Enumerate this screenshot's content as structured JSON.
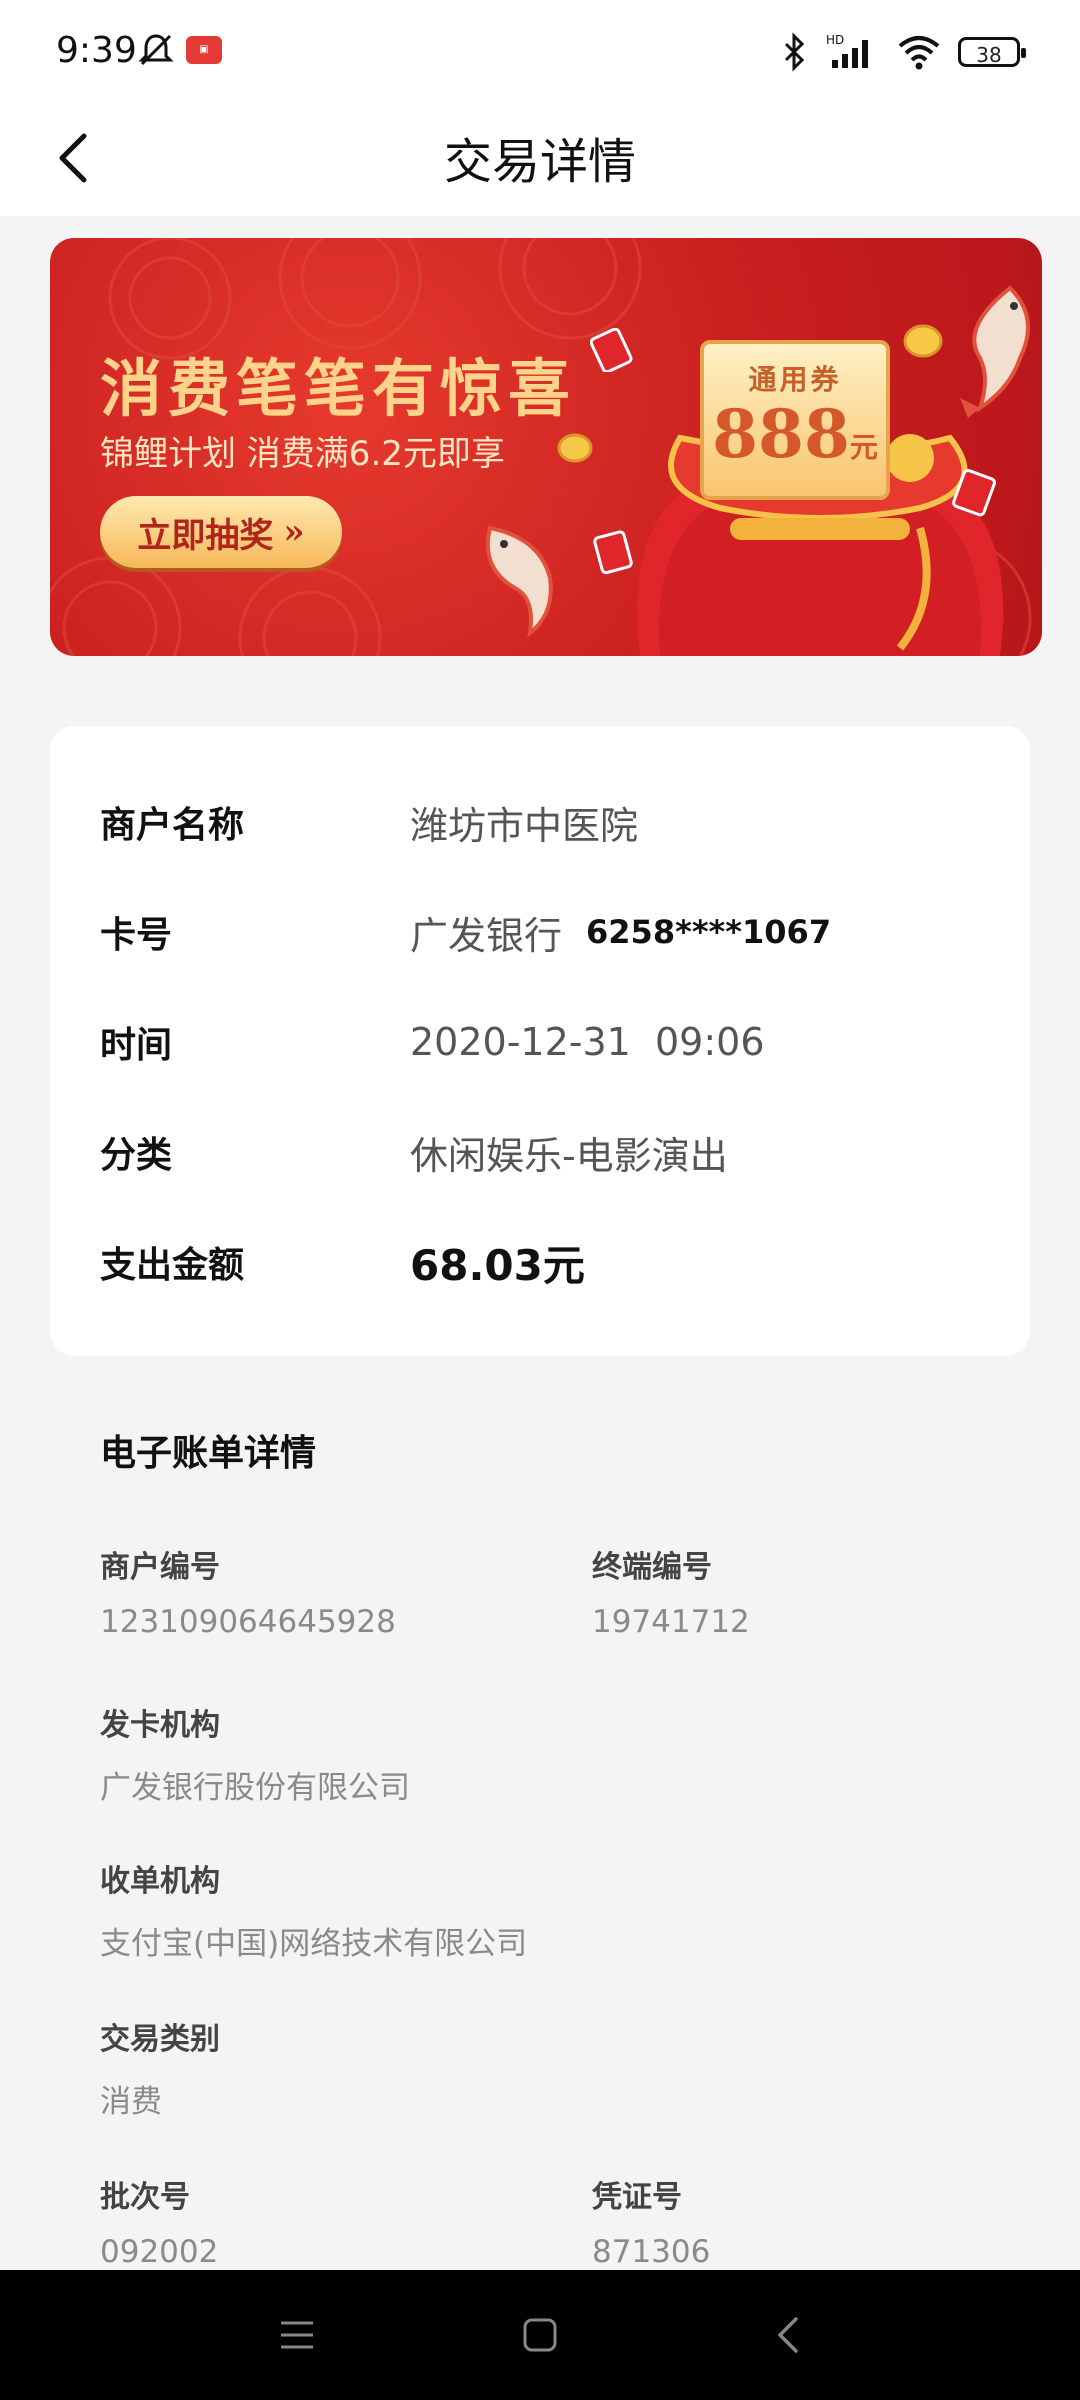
{
  "status_bar": {
    "time": "9:39",
    "battery": "38",
    "icons": [
      "mute-bell-icon",
      "app-notification-icon",
      "bluetooth-icon",
      "hd-signal-icon",
      "wifi-icon",
      "battery-icon"
    ]
  },
  "header": {
    "title": "交易详情",
    "back_icon": "chevron-left-icon"
  },
  "banner": {
    "title": "消费笔笔有惊喜",
    "subtitle": "锦鲤计划 消费满6.2元即享",
    "button_label": "立即抽奖",
    "coupon_label": "通用券",
    "coupon_value": "888",
    "coupon_unit": "元",
    "colors": {
      "background": "#c91f1f",
      "gold": "#ffd38a"
    }
  },
  "transaction": {
    "merchant_label": "商户名称",
    "merchant_value": "潍坊市中医院",
    "card_label": "卡号",
    "card_bank": "广发银行",
    "card_number": "6258****1067",
    "time_label": "时间",
    "time_value": "2020-12-31  09:06",
    "category_label": "分类",
    "category_value": "休闲娱乐-电影演出",
    "amount_label": "支出金额",
    "amount_value": "68.03元"
  },
  "bill": {
    "title": "电子账单详情",
    "merchant_no_label": "商户编号",
    "merchant_no_value": "123109064645928",
    "terminal_no_label": "终端编号",
    "terminal_no_value": "19741712",
    "issuer_label": "发卡机构",
    "issuer_value": "广发银行股份有限公司",
    "acquirer_label": "收单机构",
    "acquirer_value": "支付宝(中国)网络技术有限公司",
    "type_label": "交易类别",
    "type_value": "消费",
    "batch_label": "批次号",
    "batch_value": "092002",
    "voucher_label": "凭证号",
    "voucher_value": "871306"
  },
  "nav_bar": {
    "icons": [
      "menu-icon",
      "home-square-icon",
      "back-triangle-icon"
    ]
  }
}
